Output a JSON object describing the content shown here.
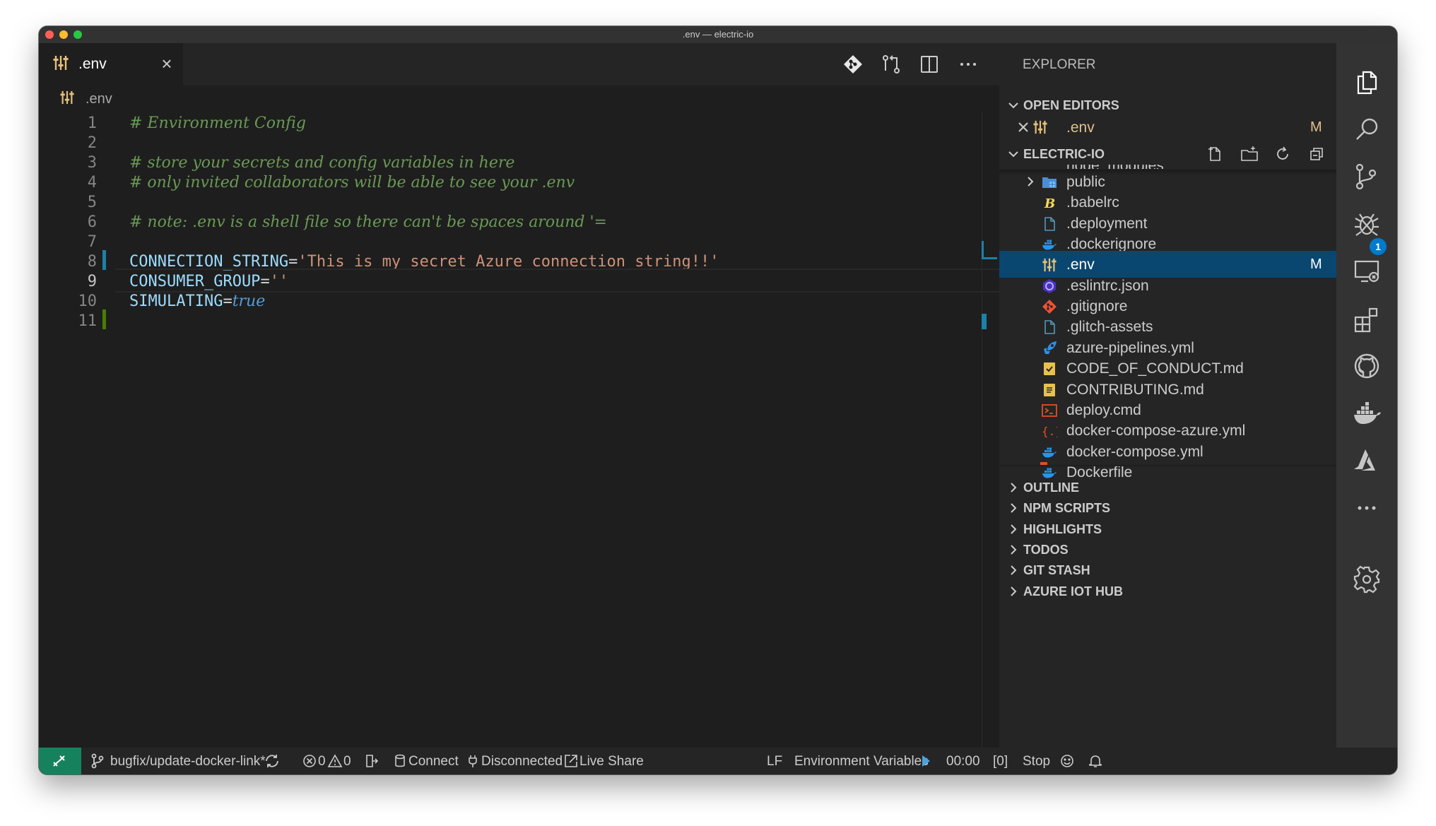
{
  "window": {
    "title": ".env — electric-io"
  },
  "editor": {
    "tab_label": ".env",
    "breadcrumb": ".env",
    "lines": [
      {
        "n": "1",
        "kind": "comment",
        "text": "# Environment Config"
      },
      {
        "n": "2",
        "kind": "blank",
        "text": ""
      },
      {
        "n": "3",
        "kind": "comment",
        "text": "# store your secrets and config variables in here"
      },
      {
        "n": "4",
        "kind": "comment",
        "text": "# only invited collaborators will be able to see your .env"
      },
      {
        "n": "5",
        "kind": "blank",
        "text": ""
      },
      {
        "n": "6",
        "kind": "comment",
        "text": "# note: .env is a shell file so there can't be spaces around '="
      },
      {
        "n": "7",
        "kind": "blank",
        "text": ""
      },
      {
        "n": "8",
        "kind": "assign",
        "key": "CONNECTION_STRING",
        "eq": "=",
        "value": "'This is my secret Azure connection string!!'"
      },
      {
        "n": "9",
        "kind": "assign",
        "key": "CONSUMER_GROUP",
        "eq": "=",
        "value": "''"
      },
      {
        "n": "10",
        "kind": "assign_bool",
        "key": "SIMULATING",
        "eq": "=",
        "value": "true"
      },
      {
        "n": "11",
        "kind": "blank",
        "text": ""
      }
    ]
  },
  "sidebar": {
    "title": "EXPLORER",
    "open_editors": {
      "label": "OPEN EDITORS",
      "item": ".env",
      "status": "M"
    },
    "project": {
      "label": "ELECTRIC-IO",
      "partial_top": "node_modules"
    },
    "files": [
      {
        "name": "public",
        "icon": "folder-public-icon"
      },
      {
        "name": ".babelrc",
        "icon": "babel-icon"
      },
      {
        "name": ".deployment",
        "icon": "file-icon"
      },
      {
        "name": ".dockerignore",
        "icon": "docker-icon"
      },
      {
        "name": ".env",
        "icon": "env-settings-icon",
        "status": "M"
      },
      {
        "name": ".eslintrc.json",
        "icon": "eslint-icon"
      },
      {
        "name": ".gitignore",
        "icon": "git-icon"
      },
      {
        "name": ".glitch-assets",
        "icon": "file-icon"
      },
      {
        "name": "azure-pipelines.yml",
        "icon": "azure-pipelines-icon"
      },
      {
        "name": "CODE_OF_CONDUCT.md",
        "icon": "checklist-icon"
      },
      {
        "name": "CONTRIBUTING.md",
        "icon": "document-icon"
      },
      {
        "name": "deploy.cmd",
        "icon": "terminal-icon"
      },
      {
        "name": "docker-compose-azure.yml",
        "icon": "braces-icon"
      },
      {
        "name": "docker-compose.yml",
        "icon": "docker-icon"
      },
      {
        "name": "Dockerfile",
        "icon": "docker-icon"
      }
    ],
    "sections": [
      "OUTLINE",
      "NPM SCRIPTS",
      "HIGHLIGHTS",
      "TODOS",
      "GIT STASH",
      "AZURE IOT HUB"
    ]
  },
  "activity": {
    "scm_badge": "1"
  },
  "statusbar": {
    "branch": "bugfix/update-docker-link*",
    "errors": "0",
    "warnings": "0",
    "connect": "Connect",
    "disconnected": "Disconnected",
    "live_share": "Live Share",
    "eol": "LF",
    "language": "Environment Variables",
    "timer": "00:00",
    "bracket_count": "[0]",
    "stop": "Stop"
  },
  "colors": {
    "accent": "#007acc",
    "selection": "#094771",
    "remote": "#16825d",
    "modified": "#e2c08d",
    "comment": "#6a9955",
    "string": "#ce9178",
    "keyword": "#569cd6",
    "variable": "#9cdcfe"
  }
}
